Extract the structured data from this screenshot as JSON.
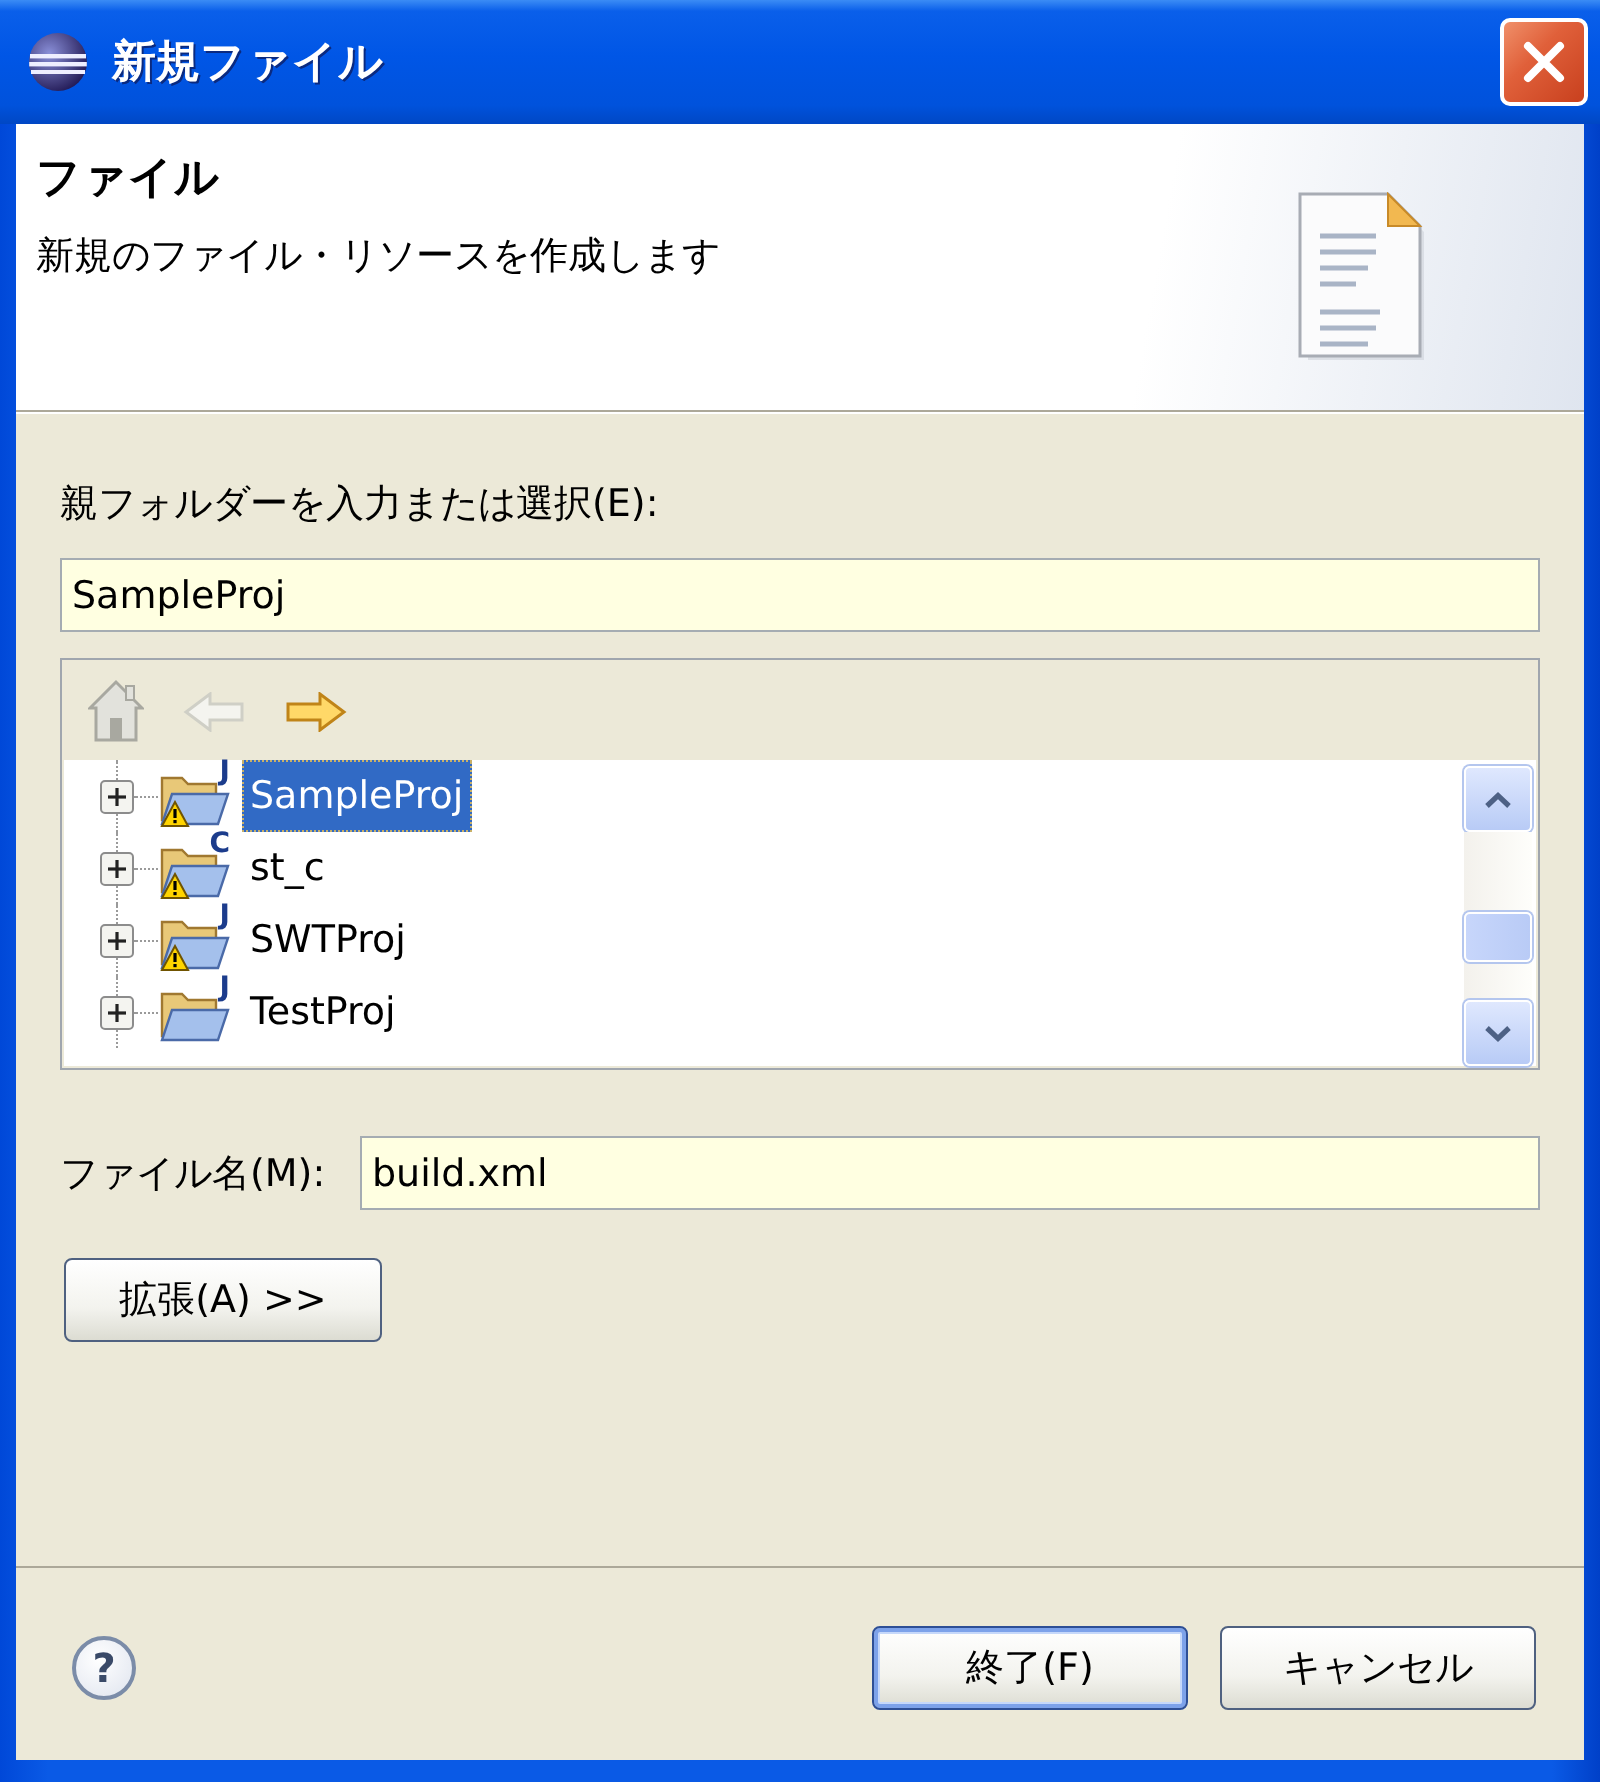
{
  "window": {
    "title": "新規ファイル"
  },
  "header": {
    "title": "ファイル",
    "description": "新規のファイル・リソースを作成します"
  },
  "parent_folder": {
    "label": "親フォルダーを入力または選択(E):",
    "value": "SampleProj"
  },
  "tree_toolbar": [
    {
      "kind": "home",
      "disabled": true
    },
    {
      "kind": "back",
      "disabled": true
    },
    {
      "kind": "forward",
      "disabled": false
    }
  ],
  "tree": [
    {
      "label": "SampleProj",
      "badge": "J",
      "warning": true,
      "expanded": false,
      "selected": true
    },
    {
      "label": "st_c",
      "badge": "C",
      "warning": true,
      "expanded": false,
      "selected": false
    },
    {
      "label": "SWTProj",
      "badge": "J",
      "warning": true,
      "expanded": false,
      "selected": false
    },
    {
      "label": "TestProj",
      "badge": "J",
      "warning": false,
      "expanded": false,
      "selected": false
    }
  ],
  "file_name": {
    "label": "ファイル名(M):",
    "value": "build.xml"
  },
  "advanced_button": {
    "label": "拡張(A) >>"
  },
  "help": {
    "glyph": "?"
  },
  "buttons": [
    {
      "label": "終了(F)",
      "default": true
    },
    {
      "label": "キャンセル",
      "default": false
    }
  ]
}
